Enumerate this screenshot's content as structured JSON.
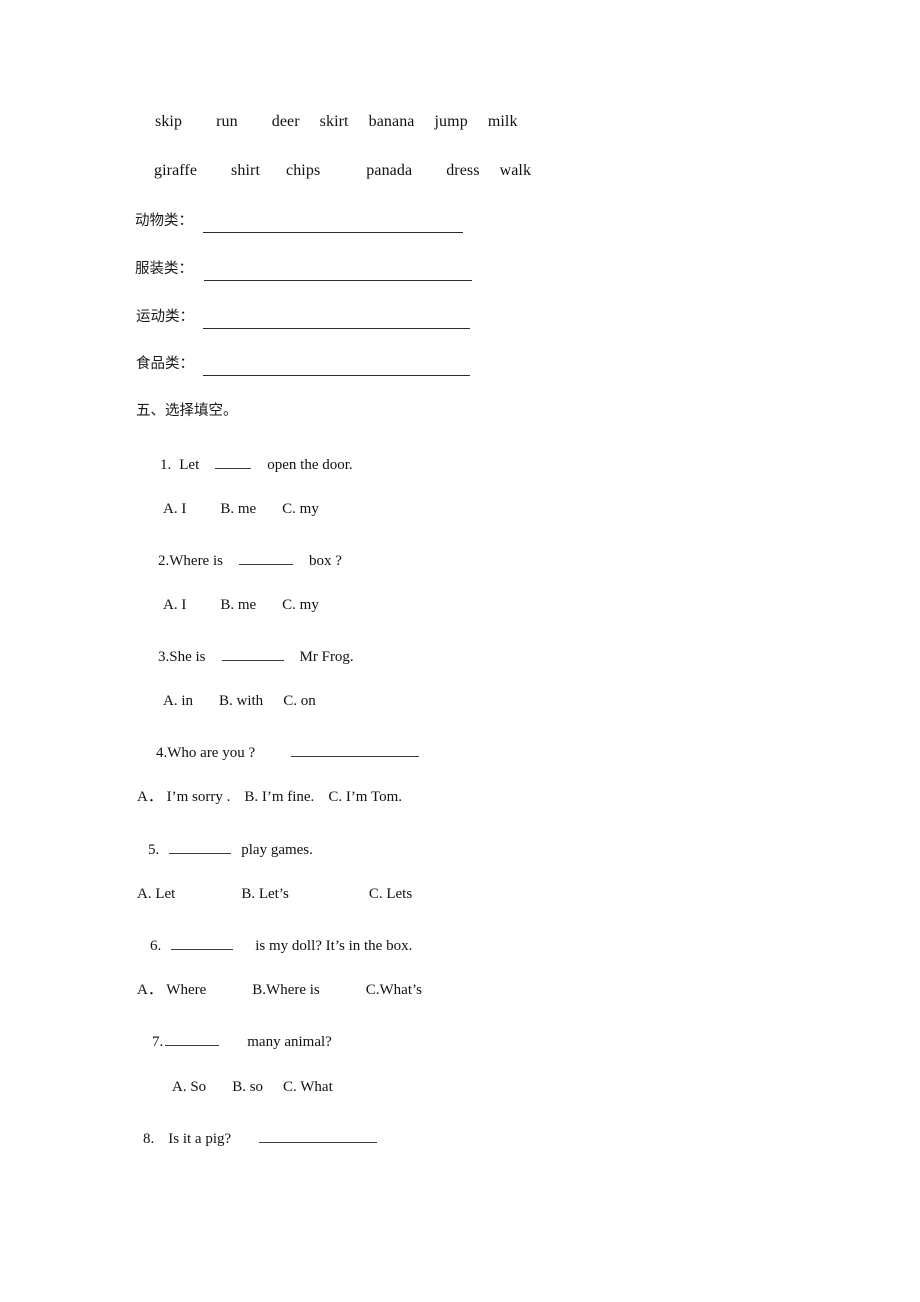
{
  "document": {
    "word_bank": {
      "row1": [
        "skip",
        "run",
        "deer",
        "skirt",
        "banana",
        "jump",
        "milk"
      ],
      "row2": [
        "giraffe",
        "shirt",
        "chips",
        "panada",
        "dress",
        "walk"
      ]
    },
    "categories": [
      {
        "label": "动物类："
      },
      {
        "label": "服装类："
      },
      {
        "label": "运动类："
      },
      {
        "label": "食品类："
      }
    ],
    "section": {
      "heading": "五、选择填空。"
    },
    "questions": [
      {
        "number": "1.",
        "stem_before": "Let",
        "stem_after": "open    the    door.",
        "options": [
          "A.   I",
          "B.   me",
          "C.   my"
        ]
      },
      {
        "number": "2.",
        "stem_before": "Where   is",
        "stem_after": "box ?",
        "options": [
          "A.   I",
          "B.   me",
          "C.   my"
        ]
      },
      {
        "number": "3.",
        "stem_before": "She    is",
        "stem_after": "Mr   Frog.",
        "options": [
          "A.   in",
          "B.   with",
          "C. on"
        ]
      },
      {
        "number": "4.",
        "stem_before": "Who   are   you ?",
        "stem_after": "",
        "options": [
          "A．  I’m   sorry .",
          "B. I’m fine.",
          "C. I’m   Tom."
        ]
      },
      {
        "number": "5.",
        "stem_before": "",
        "stem_after": "play games.",
        "options": [
          "A.   Let",
          "B.   Let’s",
          "C.   Lets"
        ]
      },
      {
        "number": "6.",
        "stem_before": "",
        "stem_after": "is my doll?    It’s   in   the box.",
        "options": [
          "A．  Where",
          "B.Where   is",
          "C.What’s"
        ]
      },
      {
        "number": "7.",
        "stem_before": "",
        "stem_after": "many   animal?",
        "options": [
          "A.   So",
          "B.   so",
          "C. What"
        ]
      },
      {
        "number": "8.",
        "stem_before": "Is   it   a   pig?",
        "stem_after": "",
        "options": []
      }
    ]
  }
}
